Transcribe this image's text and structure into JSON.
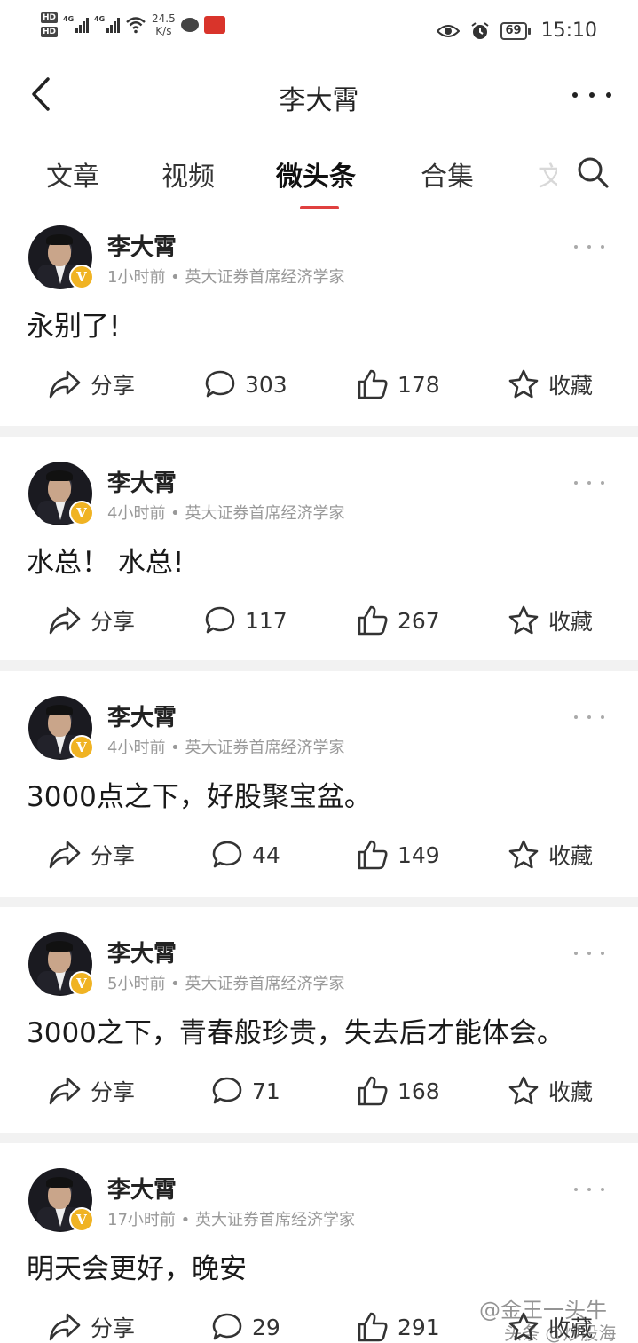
{
  "status_bar": {
    "hd1": "HD",
    "hd2": "HD",
    "net1": "4G",
    "net2": "4G",
    "speed_value": "24.5",
    "speed_unit": "K/s",
    "battery": "69",
    "time": "15:10"
  },
  "header": {
    "title": "李大霄"
  },
  "tabs": {
    "items": [
      {
        "label": "文章"
      },
      {
        "label": "视频"
      },
      {
        "label": "微头条"
      },
      {
        "label": "合集"
      }
    ],
    "active_index": 2,
    "accent_color": "#e0403f"
  },
  "posts": [
    {
      "author": "李大霄",
      "meta": "1小时前 • 英大证券首席经济学家",
      "content": "永别了!",
      "share": "分享",
      "comments": "303",
      "likes": "178",
      "favorite": "收藏"
    },
    {
      "author": "李大霄",
      "meta": "4小时前 • 英大证券首席经济学家",
      "content": "水总！ 水总!",
      "share": "分享",
      "comments": "117",
      "likes": "267",
      "favorite": "收藏"
    },
    {
      "author": "李大霄",
      "meta": "4小时前 • 英大证券首席经济学家",
      "content": "3000点之下，好股聚宝盆。",
      "share": "分享",
      "comments": "44",
      "likes": "149",
      "favorite": "收藏"
    },
    {
      "author": "李大霄",
      "meta": "5小时前 • 英大证券首席经济学家",
      "content": "3000之下，青春般珍贵，失去后才能体会。",
      "share": "分享",
      "comments": "71",
      "likes": "168",
      "favorite": "收藏"
    },
    {
      "author": "李大霄",
      "meta": "17小时前 • 英大证券首席经济学家",
      "content": "明天会更好，晚安",
      "share": "分享",
      "comments": "29",
      "likes": "291",
      "favorite": "收藏"
    }
  ],
  "watermark": {
    "line1": "@金王一头牛",
    "line2": "头条 @炒股海"
  },
  "icons": {
    "back": "chevron-left-icon",
    "more": "more-horizontal-icon",
    "search": "search-icon",
    "share": "share-arrow-icon",
    "comment": "comment-bubble-icon",
    "like": "thumbs-up-icon",
    "favorite": "star-icon",
    "verified": "verified-v-badge-icon"
  }
}
